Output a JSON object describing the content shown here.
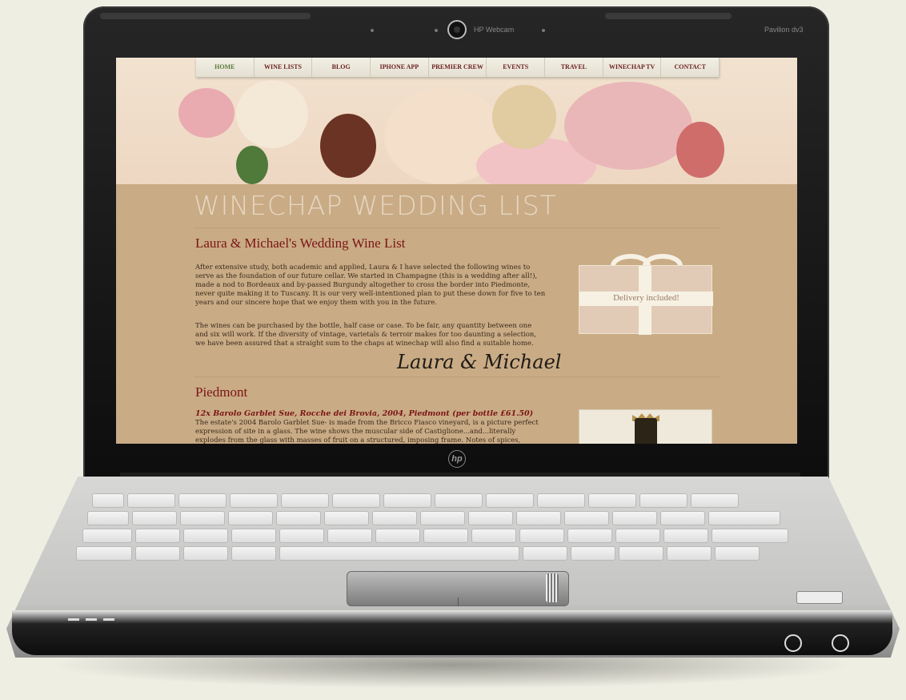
{
  "device": {
    "webcam_label": "HP Webcam",
    "model_label": "Pavilion dv3",
    "brand_logo": "hp"
  },
  "nav": [
    {
      "label": "HOME",
      "key": "home"
    },
    {
      "label": "WINE LISTS",
      "key": "wine-lists"
    },
    {
      "label": "BLOG",
      "key": "blog"
    },
    {
      "label": "IPHONE APP",
      "key": "iphone-app"
    },
    {
      "label": "PREMIER CREW",
      "key": "premier-crew"
    },
    {
      "label": "EVENTS",
      "key": "events"
    },
    {
      "label": "TRAVEL",
      "key": "travel"
    },
    {
      "label": "WINECHAP TV",
      "key": "winechap-tv"
    },
    {
      "label": "CONTACT",
      "key": "contact"
    }
  ],
  "page": {
    "site_title": "WINECHAP WEDDING LIST",
    "heading": "Laura & Michael's Wedding Wine List",
    "intro_paragraph": "After extensive study, both academic and applied, Laura & I have selected the following wines to serve as the foundation of our future cellar. We started in Champagne (this is a wedding after all!), made a nod to Bordeaux and by-passed Burgundy altogether to cross the border into Piedmonte, never quite making it to Tuscany. It is our very well-intentioned plan to put these down for five to ten years and our sincere hope that we enjoy them with you in the future.",
    "purchase_paragraph": "The wines can be purchased by the bottle, half case or case. To be fair, any quantity between one and six will work. If the diversity of vintage, varietals & terroir makes for too daunting a selection, we have been assured that a straight sum to the chaps at winechap will also find a suitable home.",
    "signature": "Laura & Michael",
    "gift_label": "Delivery included!"
  },
  "section": {
    "heading": "Piedmont",
    "item_title": "12x Barolo Garblet Sue, Rocche dei Brovia, 2004, Piedmont (per bottle £61.50)",
    "item_description": "The estate's 2004 Barolo Garblet Sue- is made from the Bricco Fiasco vineyard, is a picture perfect expression of site in a glass. The wine shows the muscular side of Castiglione...and...literally explodes from the glass with masses of fruit on a structured, imposing frame. Notes of spices, tobacco and licorice"
  }
}
